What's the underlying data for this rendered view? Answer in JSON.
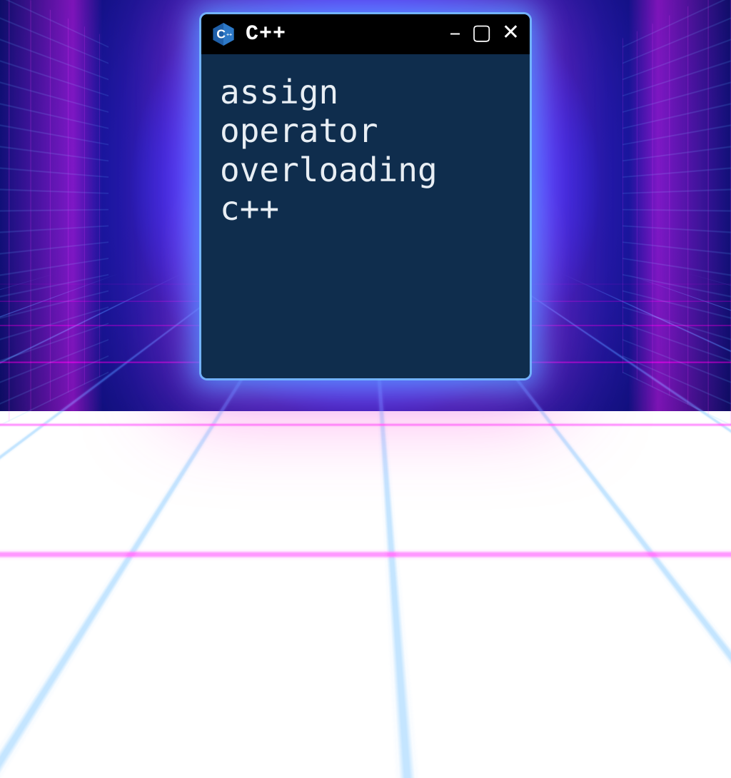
{
  "window": {
    "title": "C++",
    "controls": {
      "minimize": "–",
      "maximize": "▢",
      "close": "✕"
    },
    "content": "assign\noperator\noverloading\nc++"
  },
  "logo": {
    "letter": "C",
    "plus": "++"
  }
}
